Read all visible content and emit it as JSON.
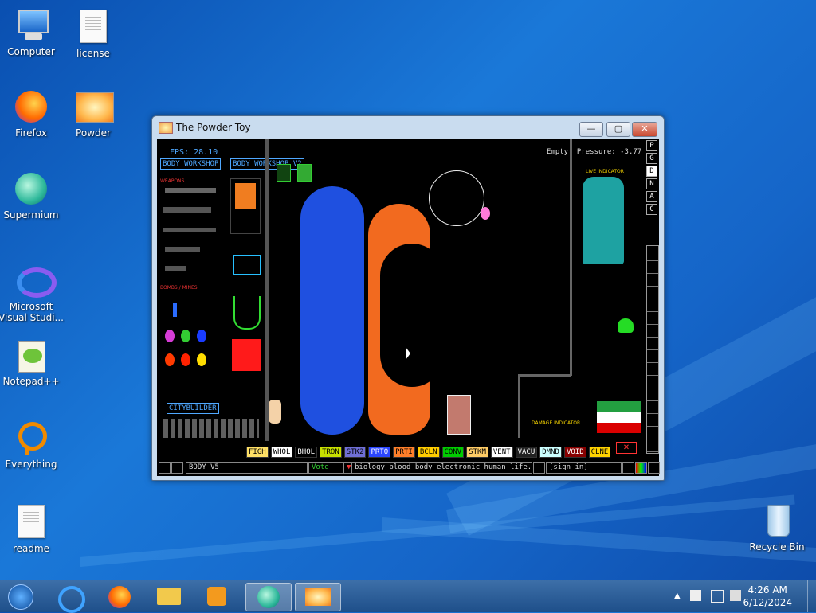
{
  "desktop": {
    "icons": [
      {
        "label": "Computer"
      },
      {
        "label": "license"
      },
      {
        "label": "Firefox"
      },
      {
        "label": "Powder"
      },
      {
        "label": "Supermium"
      },
      {
        "label": "Microsoft Visual Studi..."
      },
      {
        "label": "Notepad++"
      },
      {
        "label": "Everything"
      },
      {
        "label": "readme"
      },
      {
        "label": "Recycle Bin"
      }
    ]
  },
  "window": {
    "title": "The Powder Toy",
    "min_label": "—",
    "max_label": "▢",
    "close_label": "✕"
  },
  "game": {
    "fps": "FPS: 28.10",
    "pressure": "Empty, Pressure: -3.77",
    "tabs": [
      "BODY WORKSHOP",
      "BODY WORKSHOP V2"
    ],
    "weapons_label": "WEAPONS",
    "bombs_label": "BOMBS / MINES",
    "citybuilder": "CITYBUILDER",
    "live_indicator": "LIVE INDICATOR",
    "damage_indicator": "DAMAGE INDICATOR",
    "tags": [
      "FIGH",
      "WHOL",
      "BHOL",
      "TRON",
      "STK2",
      "PRTO",
      "PRTI",
      "BCLN",
      "CONV",
      "STKM",
      "VENT",
      "VACU",
      "DMND",
      "VOID",
      "CLNE"
    ],
    "tag_colors": [
      "#ffe066",
      "#ffffff",
      "#000000",
      "#c8e000",
      "#6f6fd6",
      "#2b46ff",
      "#ff7f2a",
      "#ffcc00",
      "#00cc00",
      "#ffcc66",
      "#ffffff",
      "#222222",
      "#ccffff",
      "#880000",
      "#ffd200"
    ],
    "tag_text_colors": [
      "#000",
      "#000",
      "#fff",
      "#000",
      "#000",
      "#fff",
      "#000",
      "#000",
      "#000",
      "#000",
      "#000",
      "#fff",
      "#000",
      "#fff",
      "#000"
    ],
    "side_letters": [
      "P",
      "G",
      "D",
      "N",
      "A",
      "C"
    ],
    "bottom": {
      "save_name": "BODY V5",
      "vote": "Vote",
      "tags_text": "biology blood body electronic human life...",
      "sign_in": "[sign in]"
    }
  },
  "taskbar": {
    "time": "4:26 AM",
    "date": "6/12/2024"
  }
}
